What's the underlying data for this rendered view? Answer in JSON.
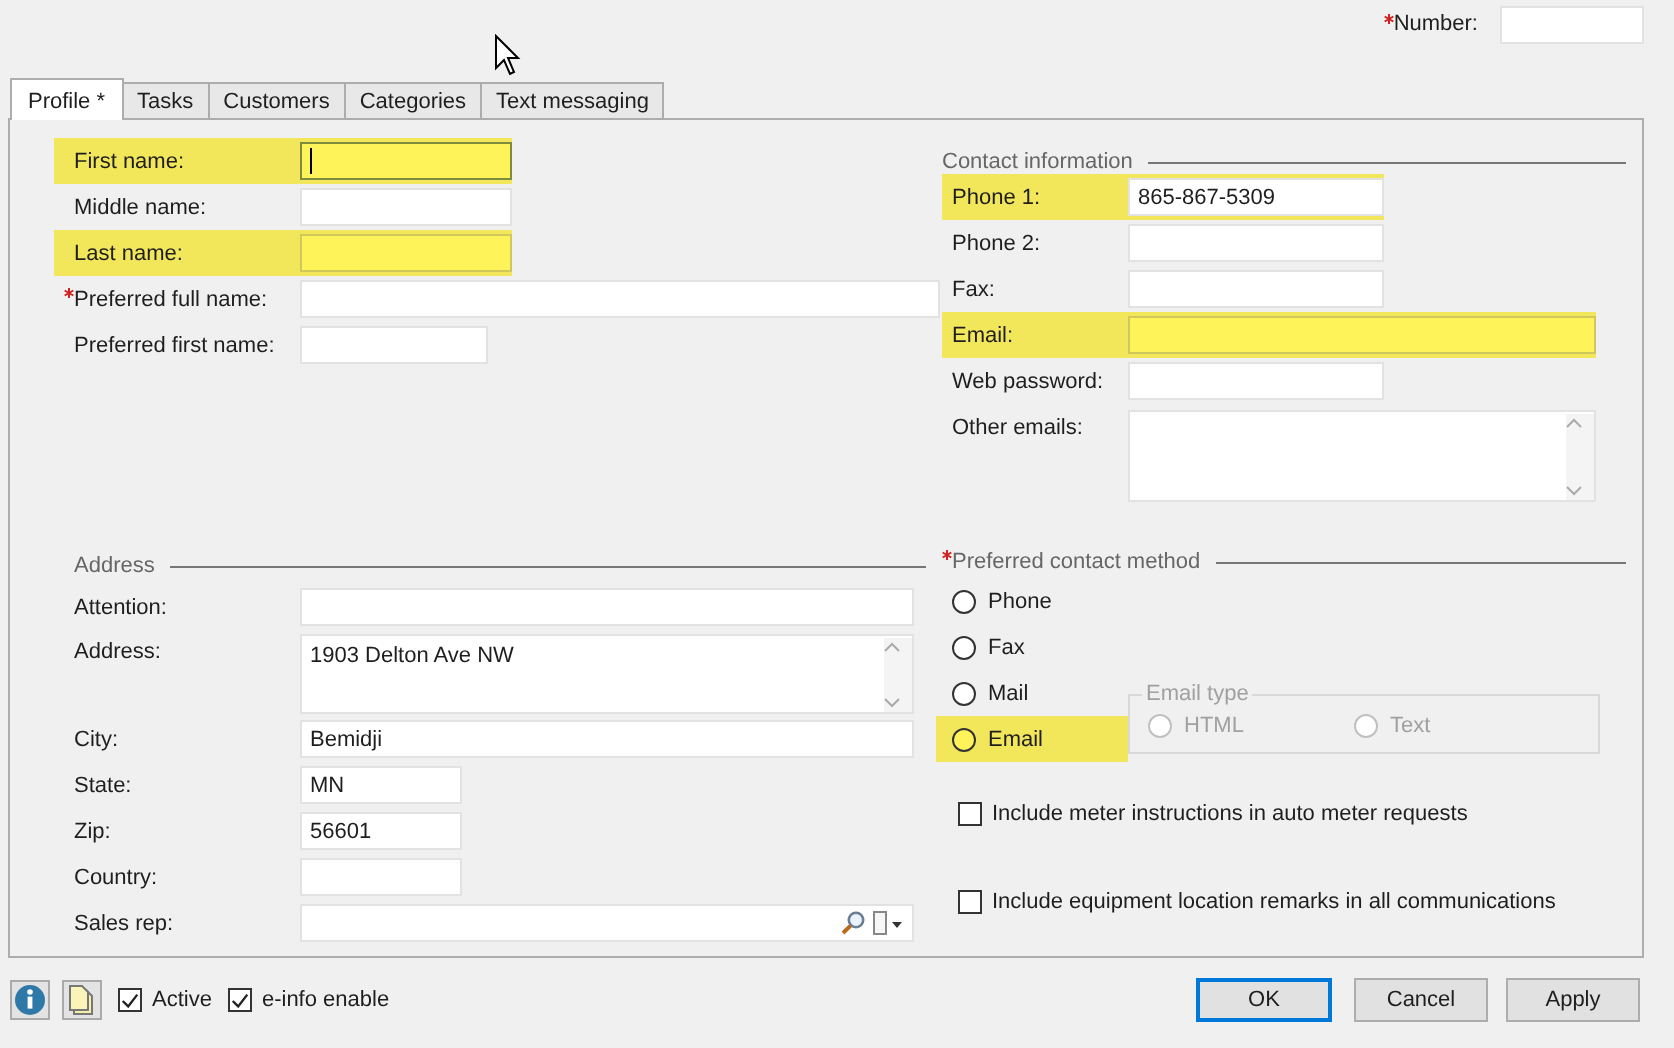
{
  "number_field": {
    "label": "Number:",
    "required": true
  },
  "tabs": [
    {
      "label": "Profile *",
      "selected": true
    },
    {
      "label": "Tasks",
      "selected": false
    },
    {
      "label": "Customers",
      "selected": false
    },
    {
      "label": "Categories",
      "selected": false
    },
    {
      "label": "Text messaging",
      "selected": false
    }
  ],
  "name_fields": [
    {
      "label": "First name:",
      "required": false,
      "highlighted": true,
      "focused": true
    },
    {
      "label": "Middle name:",
      "required": false,
      "highlighted": false,
      "focused": false
    },
    {
      "label": "Last name:",
      "required": false,
      "highlighted": true,
      "focused": false
    },
    {
      "label": "Preferred full name:",
      "required": true,
      "highlighted": false,
      "focused": false
    },
    {
      "label": "Preferred first name:",
      "required": false,
      "highlighted": false,
      "focused": false
    }
  ],
  "address": {
    "title": "Address",
    "fields": [
      {
        "label": "Attention:",
        "kind": "text"
      },
      {
        "label": "Address:",
        "value": "1903 Delton Ave NW",
        "kind": "multiline"
      },
      {
        "label": "City:",
        "value": "Bemidji",
        "kind": "text"
      },
      {
        "label": "State:",
        "value": "MN",
        "kind": "text"
      },
      {
        "label": "Zip:",
        "value": "56601",
        "kind": "text"
      },
      {
        "label": "Country:",
        "kind": "text"
      },
      {
        "label": "Sales rep:",
        "kind": "lookup"
      }
    ]
  },
  "contact": {
    "title": "Contact information",
    "fields": [
      {
        "label": "Phone 1:",
        "value": "865-867-5309",
        "kind": "text",
        "highlighted": true
      },
      {
        "label": "Phone 2:",
        "kind": "text",
        "highlighted": false
      },
      {
        "label": "Fax:",
        "kind": "text",
        "highlighted": false
      },
      {
        "label": "Email:",
        "kind": "text",
        "highlighted": true
      },
      {
        "label": "Web password:",
        "kind": "text",
        "highlighted": false
      },
      {
        "label": "Other emails:",
        "kind": "multiline",
        "highlighted": false
      }
    ]
  },
  "contact_method": {
    "title": "Preferred contact method",
    "required": true,
    "options": [
      {
        "label": "Phone",
        "selected": false,
        "highlighted": false
      },
      {
        "label": "Fax",
        "selected": false,
        "highlighted": false
      },
      {
        "label": "Mail",
        "selected": false,
        "highlighted": false
      },
      {
        "label": "Email",
        "selected": false,
        "highlighted": true
      }
    ],
    "email_type": {
      "title": "Email type",
      "disabled": true,
      "options": [
        {
          "label": "HTML",
          "selected": false
        },
        {
          "label": "Text",
          "selected": false
        }
      ]
    }
  },
  "options": [
    {
      "label": "Include meter instructions in auto meter requests",
      "checked": false
    },
    {
      "label": "Include equipment location remarks in all communications",
      "checked": false
    }
  ],
  "footer": {
    "checkboxes": [
      {
        "label": "Active",
        "checked": true
      },
      {
        "label": "e-info enable",
        "checked": true
      }
    ],
    "buttons": [
      {
        "label": "OK",
        "focused": true
      },
      {
        "label": "Cancel",
        "focused": false
      },
      {
        "label": "Apply",
        "focused": false
      }
    ]
  }
}
